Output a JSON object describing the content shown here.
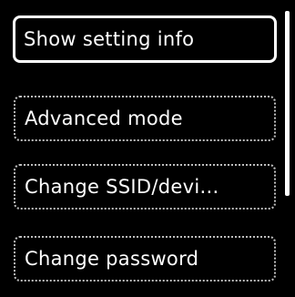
{
  "menu": {
    "items": [
      {
        "label": "Show setting info",
        "selected": true
      },
      {
        "label": "Advanced mode",
        "selected": false
      },
      {
        "label": "Change SSID/devi...",
        "selected": false
      },
      {
        "label": "Change password",
        "selected": false
      }
    ]
  },
  "colors": {
    "background": "#000000",
    "text": "#ffffff",
    "selected_border": "#ffffff",
    "item_border": "#bdbdbd"
  }
}
